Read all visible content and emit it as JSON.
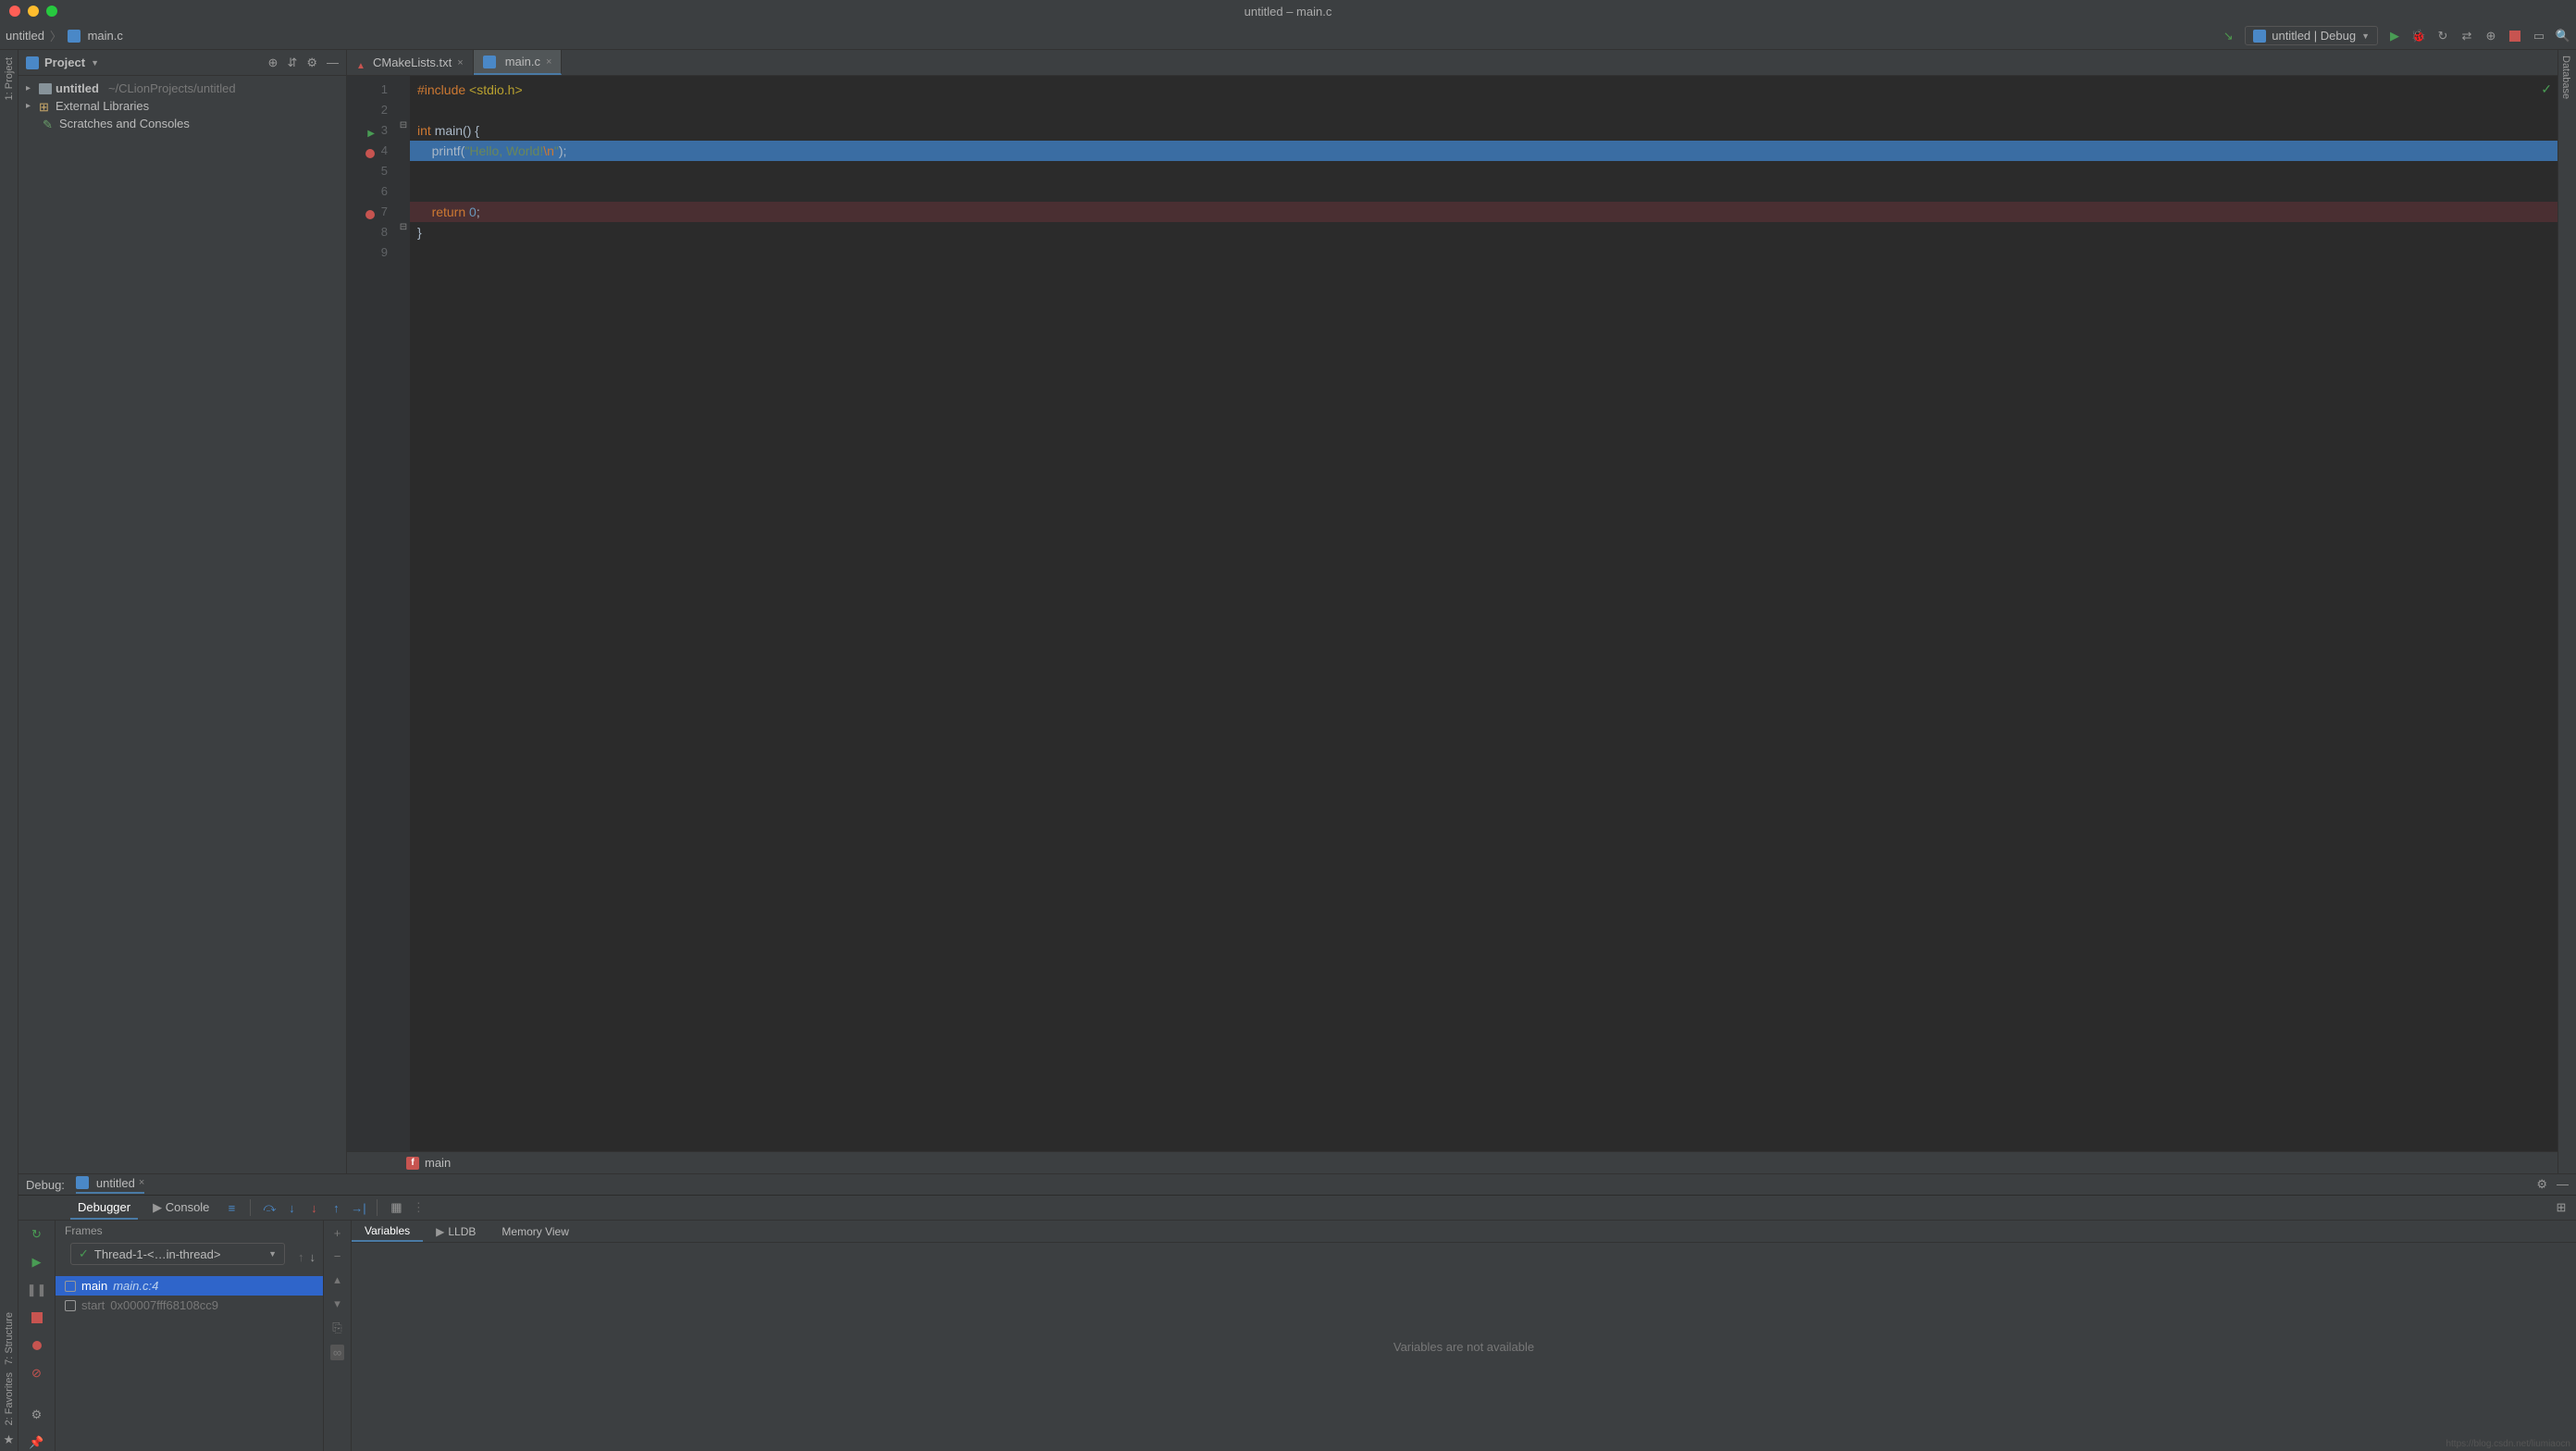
{
  "window": {
    "title": "untitled – main.c"
  },
  "breadcrumb": {
    "project": "untitled",
    "file": "main.c",
    "sep": "〉"
  },
  "run_config": {
    "label": "untitled | Debug"
  },
  "project_panel": {
    "title": "Project",
    "root": {
      "name": "untitled",
      "path": "~/CLionProjects/untitled"
    },
    "ext_libs": "External Libraries",
    "scratches": "Scratches and Consoles"
  },
  "editor_tabs": [
    {
      "label": "CMakeLists.txt",
      "active": false
    },
    {
      "label": "main.c",
      "active": true
    }
  ],
  "code": {
    "line1_kw": "#include",
    "line1_inc": "<stdio.h>",
    "line3_kw": "int",
    "line3_fn": "main",
    "line3_rest": "() {",
    "line4_fn": "printf",
    "line4_open": "(",
    "line4_str": "\"Hello, World!",
    "line4_esc": "\\n",
    "line4_strend": "\"",
    "line4_close": ");",
    "line7_kw": "return",
    "line7_num": "0",
    "line7_semi": ";",
    "line8": "}"
  },
  "gutter_lines": [
    "1",
    "2",
    "3",
    "4",
    "5",
    "6",
    "7",
    "8",
    "9"
  ],
  "editor_breadcrumb": {
    "fn": "main",
    "badge": "f"
  },
  "debug": {
    "title": "Debug:",
    "session": "untitled",
    "tabs": {
      "debugger": "Debugger",
      "console": "Console"
    },
    "frames_label": "Frames",
    "thread": "Thread-1-<…in-thread>",
    "frame1": {
      "name": "main",
      "loc": "main.c:4"
    },
    "frame2": {
      "name": "start",
      "addr": "0x00007fff68108cc9"
    },
    "vars_tabs": {
      "variables": "Variables",
      "lldb": "LLDB",
      "memory": "Memory View"
    },
    "vars_empty": "Variables are not available"
  },
  "sidebars": {
    "project_lbl": "1: Project",
    "structure_lbl": "7: Structure",
    "favorites_lbl": "2: Favorites",
    "database_lbl": "Database"
  },
  "watermark": "https://blog.csdn.net/liumiaocn"
}
